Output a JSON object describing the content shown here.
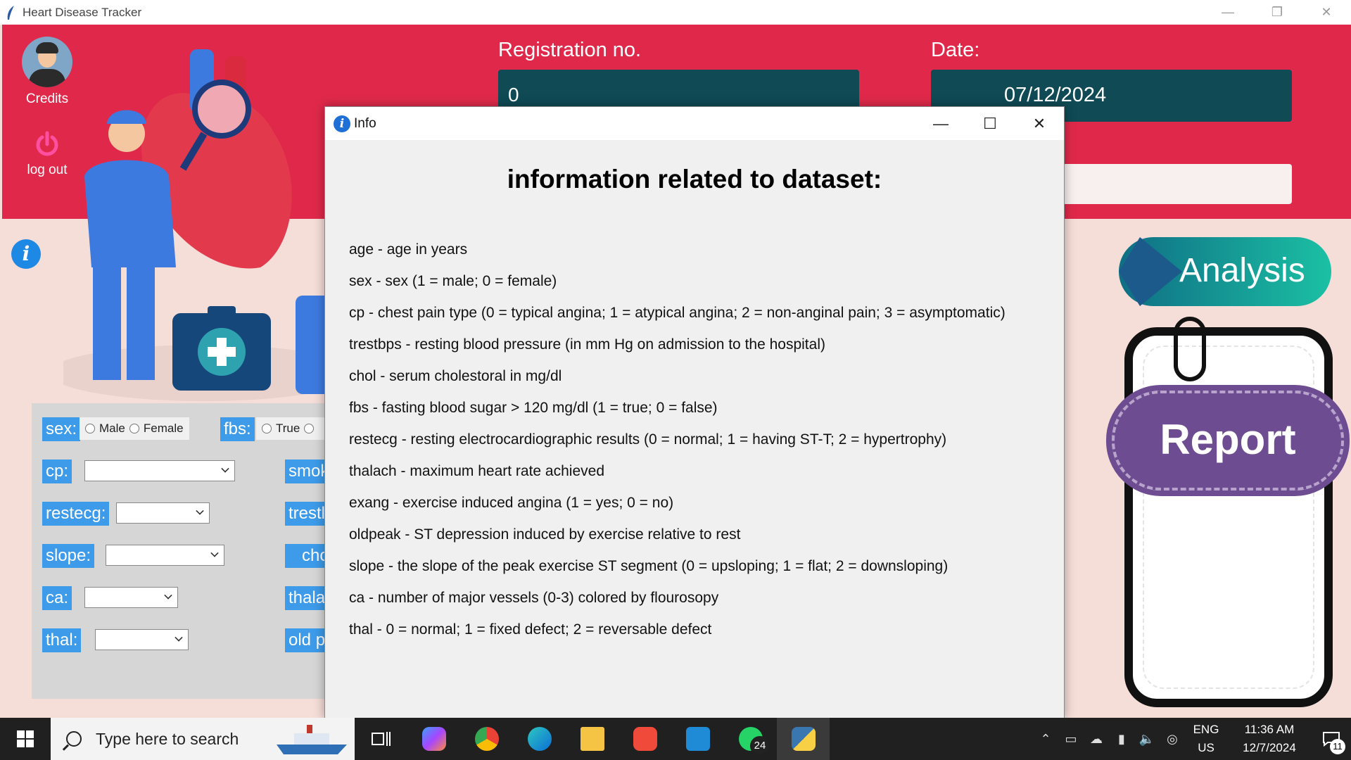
{
  "window": {
    "title": "Heart Disease Tracker",
    "minimize": "—",
    "restore": "❐",
    "close": "✕"
  },
  "sidebar": {
    "credits_label": "Credits",
    "logout_label": "log out",
    "info_glyph": "i"
  },
  "header": {
    "reg_label": "Registration no.",
    "reg_value": "0",
    "date_label": "Date:",
    "date_value": "07/12/2024",
    "name_value": ""
  },
  "form": {
    "sex_label": "sex:",
    "sex_options": [
      "Male",
      "Female"
    ],
    "fbs_label": "fbs:",
    "fbs_options": [
      "True"
    ],
    "cp_label": "cp:",
    "restecg_label": "restecg:",
    "slope_label": "slope:",
    "ca_label": "ca:",
    "thal_label": "thal:",
    "smoking_label": "smok",
    "trestbps_label": "trestl",
    "chol_label": "cho",
    "thalach_label": "thala",
    "oldpeak_label": "old p"
  },
  "right": {
    "analysis_label": "Analysis",
    "report_label": "Report"
  },
  "dialog": {
    "title": "Info",
    "heading": "information related to dataset:",
    "lines": [
      "age - age in years",
      "sex - sex (1 = male; 0 = female)",
      "cp - chest pain type (0 = typical angina; 1 = atypical angina; 2 = non-anginal pain; 3 = asymptomatic)",
      "trestbps - resting blood pressure (in mm Hg on admission to the hospital)",
      "chol - serum cholestoral in mg/dl",
      "fbs - fasting blood sugar > 120 mg/dl (1 = true; 0 = false)",
      "restecg - resting electrocardiographic results (0 = normal; 1 = having ST-T; 2 = hypertrophy)",
      "thalach - maximum heart rate achieved",
      "exang - exercise induced angina (1 = yes; 0 = no)",
      "oldpeak - ST depression induced by exercise relative to rest",
      "slope - the slope of the peak exercise ST segment (0 = upsloping; 1 = flat; 2 = downsloping)",
      "ca - number of major vessels (0-3) colored by flourosopy",
      "thal - 0 = normal; 1 = fixed defect; 2 = reversable defect"
    ]
  },
  "taskbar": {
    "search_placeholder": "Type here to search",
    "whatsapp_badge": "24",
    "lang_1": "ENG",
    "lang_2": "US",
    "time": "11:36 AM",
    "date": "12/7/2024",
    "notif_count": "11"
  },
  "colors": {
    "header_red": "#e0294a",
    "field_teal": "#0f4a55",
    "label_blue": "#3d9be9",
    "report_purple": "#6d4c91"
  }
}
